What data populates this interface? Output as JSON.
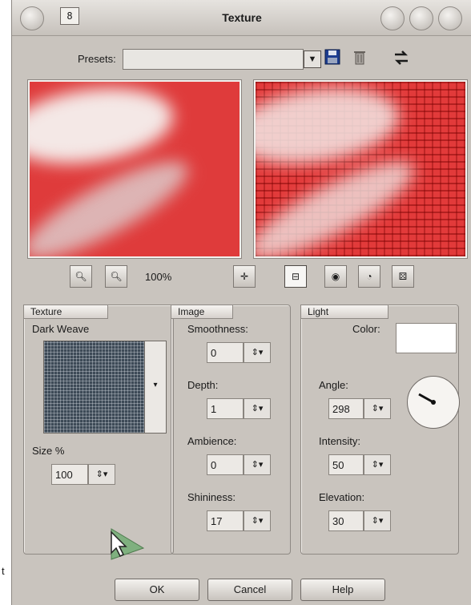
{
  "window": {
    "title": "Texture",
    "badge": "8"
  },
  "presets": {
    "label": "Presets:",
    "value": ""
  },
  "zoom": {
    "level": "100%"
  },
  "texture_panel": {
    "title": "Texture",
    "texture_name": "Dark Weave",
    "size_label": "Size %",
    "size_value": "100"
  },
  "image_panel": {
    "title": "Image",
    "smoothness_label": "Smoothness:",
    "smoothness_value": "0",
    "depth_label": "Depth:",
    "depth_value": "1",
    "ambience_label": "Ambience:",
    "ambience_value": "0",
    "shininess_label": "Shininess:",
    "shininess_value": "17"
  },
  "light_panel": {
    "title": "Light",
    "color_label": "Color:",
    "color_value": "#ffffff",
    "angle_label": "Angle:",
    "angle_value": "298",
    "intensity_label": "Intensity:",
    "intensity_value": "50",
    "elevation_label": "Elevation:",
    "elevation_value": "30"
  },
  "buttons": {
    "ok": "OK",
    "cancel": "Cancel",
    "help": "Help"
  },
  "edge_text": "t",
  "colors": {
    "dialog_bg": "#c9c4be",
    "preview_red": "#df3b3b"
  }
}
